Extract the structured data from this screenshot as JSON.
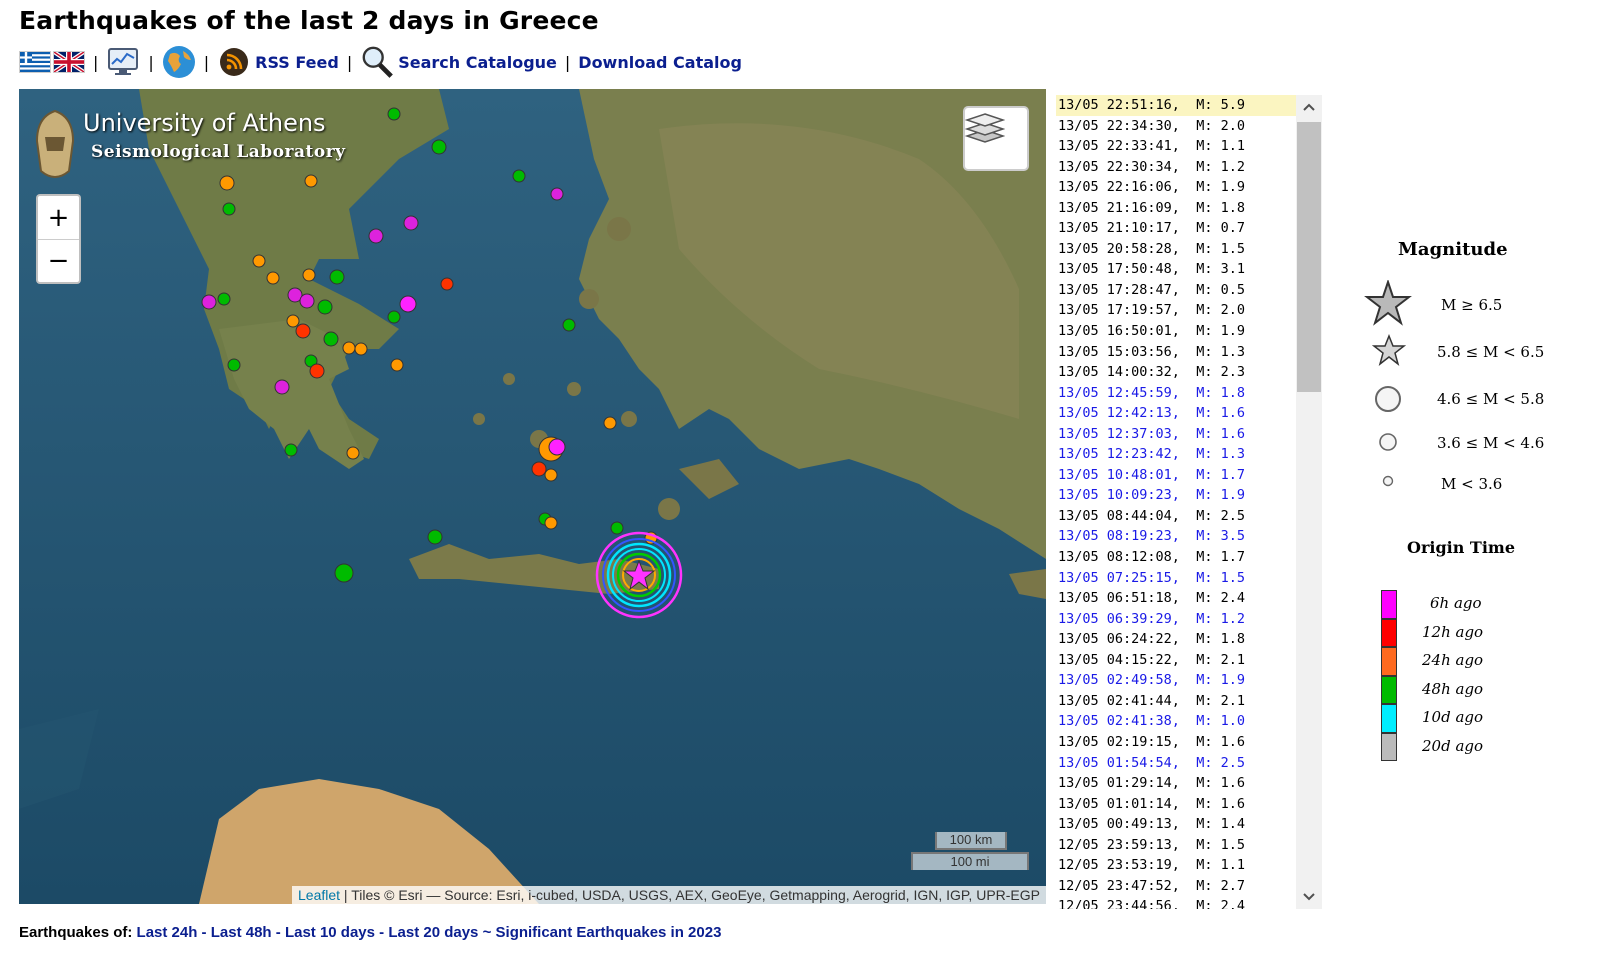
{
  "page": {
    "title": "Earthquakes of the last 2 days in Greece"
  },
  "toolbar": {
    "sep": "|",
    "rss_label": "RSS Feed",
    "search_label": "Search Catalogue",
    "download_label": "Download Catalog"
  },
  "map": {
    "logo_line1": "University of Athens",
    "logo_line2": "Seismological Laboratory",
    "zoom_in": "+",
    "zoom_out": "−",
    "scale_km": "100 km",
    "scale_mi": "100 mi",
    "attribution_link": "Leaflet",
    "attribution_text": " | Tiles © Esri — Source: Esri, i-cubed, USDA, USGS, AEX, GeoEye, Getmapping, Aerogrid, IGN, IGP, UPR-EGP",
    "colors": {
      "sea": "#1f4f6a",
      "land": "#6f7c4a",
      "desert": "#c9a06b",
      "epicenter_star": "#ff33ff"
    },
    "main_event_marker": "star-icon"
  },
  "quakes": [
    {
      "t": "13/05 22:51:16,",
      "m": "M: 5.9",
      "style": "selected"
    },
    {
      "t": "13/05 22:34:30,",
      "m": "M: 2.0",
      "style": "normal"
    },
    {
      "t": "13/05 22:33:41,",
      "m": "M: 1.1",
      "style": "normal"
    },
    {
      "t": "13/05 22:30:34,",
      "m": "M: 1.2",
      "style": "normal"
    },
    {
      "t": "13/05 22:16:06,",
      "m": "M: 1.9",
      "style": "normal"
    },
    {
      "t": "13/05 21:16:09,",
      "m": "M: 1.8",
      "style": "normal"
    },
    {
      "t": "13/05 21:10:17,",
      "m": "M: 0.7",
      "style": "normal"
    },
    {
      "t": "13/05 20:58:28,",
      "m": "M: 1.5",
      "style": "normal"
    },
    {
      "t": "13/05 17:50:48,",
      "m": "M: 3.1",
      "style": "normal"
    },
    {
      "t": "13/05 17:28:47,",
      "m": "M: 0.5",
      "style": "normal"
    },
    {
      "t": "13/05 17:19:57,",
      "m": "M: 2.0",
      "style": "normal"
    },
    {
      "t": "13/05 16:50:01,",
      "m": "M: 1.9",
      "style": "normal"
    },
    {
      "t": "13/05 15:03:56,",
      "m": "M: 1.3",
      "style": "normal"
    },
    {
      "t": "13/05 14:00:32,",
      "m": "M: 2.3",
      "style": "normal"
    },
    {
      "t": "13/05 12:45:59,",
      "m": "M: 1.8",
      "style": "blue"
    },
    {
      "t": "13/05 12:42:13,",
      "m": "M: 1.6",
      "style": "blue"
    },
    {
      "t": "13/05 12:37:03,",
      "m": "M: 1.6",
      "style": "blue"
    },
    {
      "t": "13/05 12:23:42,",
      "m": "M: 1.3",
      "style": "blue"
    },
    {
      "t": "13/05 10:48:01,",
      "m": "M: 1.7",
      "style": "blue"
    },
    {
      "t": "13/05 10:09:23,",
      "m": "M: 1.9",
      "style": "blue"
    },
    {
      "t": "13/05 08:44:04,",
      "m": "M: 2.5",
      "style": "normal"
    },
    {
      "t": "13/05 08:19:23,",
      "m": "M: 3.5",
      "style": "blue"
    },
    {
      "t": "13/05 08:12:08,",
      "m": "M: 1.7",
      "style": "normal"
    },
    {
      "t": "13/05 07:25:15,",
      "m": "M: 1.5",
      "style": "blue"
    },
    {
      "t": "13/05 06:51:18,",
      "m": "M: 2.4",
      "style": "normal"
    },
    {
      "t": "13/05 06:39:29,",
      "m": "M: 1.2",
      "style": "blue"
    },
    {
      "t": "13/05 06:24:22,",
      "m": "M: 1.8",
      "style": "normal"
    },
    {
      "t": "13/05 04:15:22,",
      "m": "M: 2.1",
      "style": "normal"
    },
    {
      "t": "13/05 02:49:58,",
      "m": "M: 1.9",
      "style": "blue"
    },
    {
      "t": "13/05 02:41:44,",
      "m": "M: 2.1",
      "style": "normal"
    },
    {
      "t": "13/05 02:41:38,",
      "m": "M: 1.0",
      "style": "blue"
    },
    {
      "t": "13/05 02:19:15,",
      "m": "M: 1.6",
      "style": "normal"
    },
    {
      "t": "13/05 01:54:54,",
      "m": "M: 2.5",
      "style": "blue"
    },
    {
      "t": "13/05 01:29:14,",
      "m": "M: 1.6",
      "style": "normal"
    },
    {
      "t": "13/05 01:01:14,",
      "m": "M: 1.6",
      "style": "normal"
    },
    {
      "t": "13/05 00:49:13,",
      "m": "M: 1.4",
      "style": "normal"
    },
    {
      "t": "12/05 23:59:13,",
      "m": "M: 1.5",
      "style": "normal"
    },
    {
      "t": "12/05 23:53:19,",
      "m": "M: 1.1",
      "style": "normal"
    },
    {
      "t": "12/05 23:47:52,",
      "m": "M: 2.7",
      "style": "normal"
    },
    {
      "t": "12/05 23:44:56,",
      "m": "M: 2.4",
      "style": "normal"
    }
  ],
  "legend": {
    "magnitude_title": "Magnitude",
    "mag_classes": [
      "M ≥ 6.5",
      "5.8 ≤  M < 6.5",
      "4.6 ≤  M < 5.8",
      "3.6 ≤  M < 4.6",
      "M < 3.6"
    ],
    "origin_title": "Origin Time",
    "time_classes": [
      {
        "label": "6h ago",
        "color": "#ff00ff"
      },
      {
        "label": "12h ago",
        "color": "#ff0000"
      },
      {
        "label": "24h ago",
        "color": "#ff6a1f"
      },
      {
        "label": "48h ago",
        "color": "#00bb00"
      },
      {
        "label": "10d ago",
        "color": "#00eeff"
      },
      {
        "label": "20d ago",
        "color": "#bbbbbb"
      }
    ]
  },
  "footer": {
    "prefix": "Earthquakes of:",
    "link_24h": "Last 24h",
    "dash1": " - ",
    "link_48h": "Last 48h",
    "dash2": " - ",
    "link_10d": "Last 10 days",
    "dash3": " - ",
    "link_20d": "Last 20 days",
    "tilde": " ~ ",
    "link_sig": "Significant Earthquakes in 2023"
  }
}
